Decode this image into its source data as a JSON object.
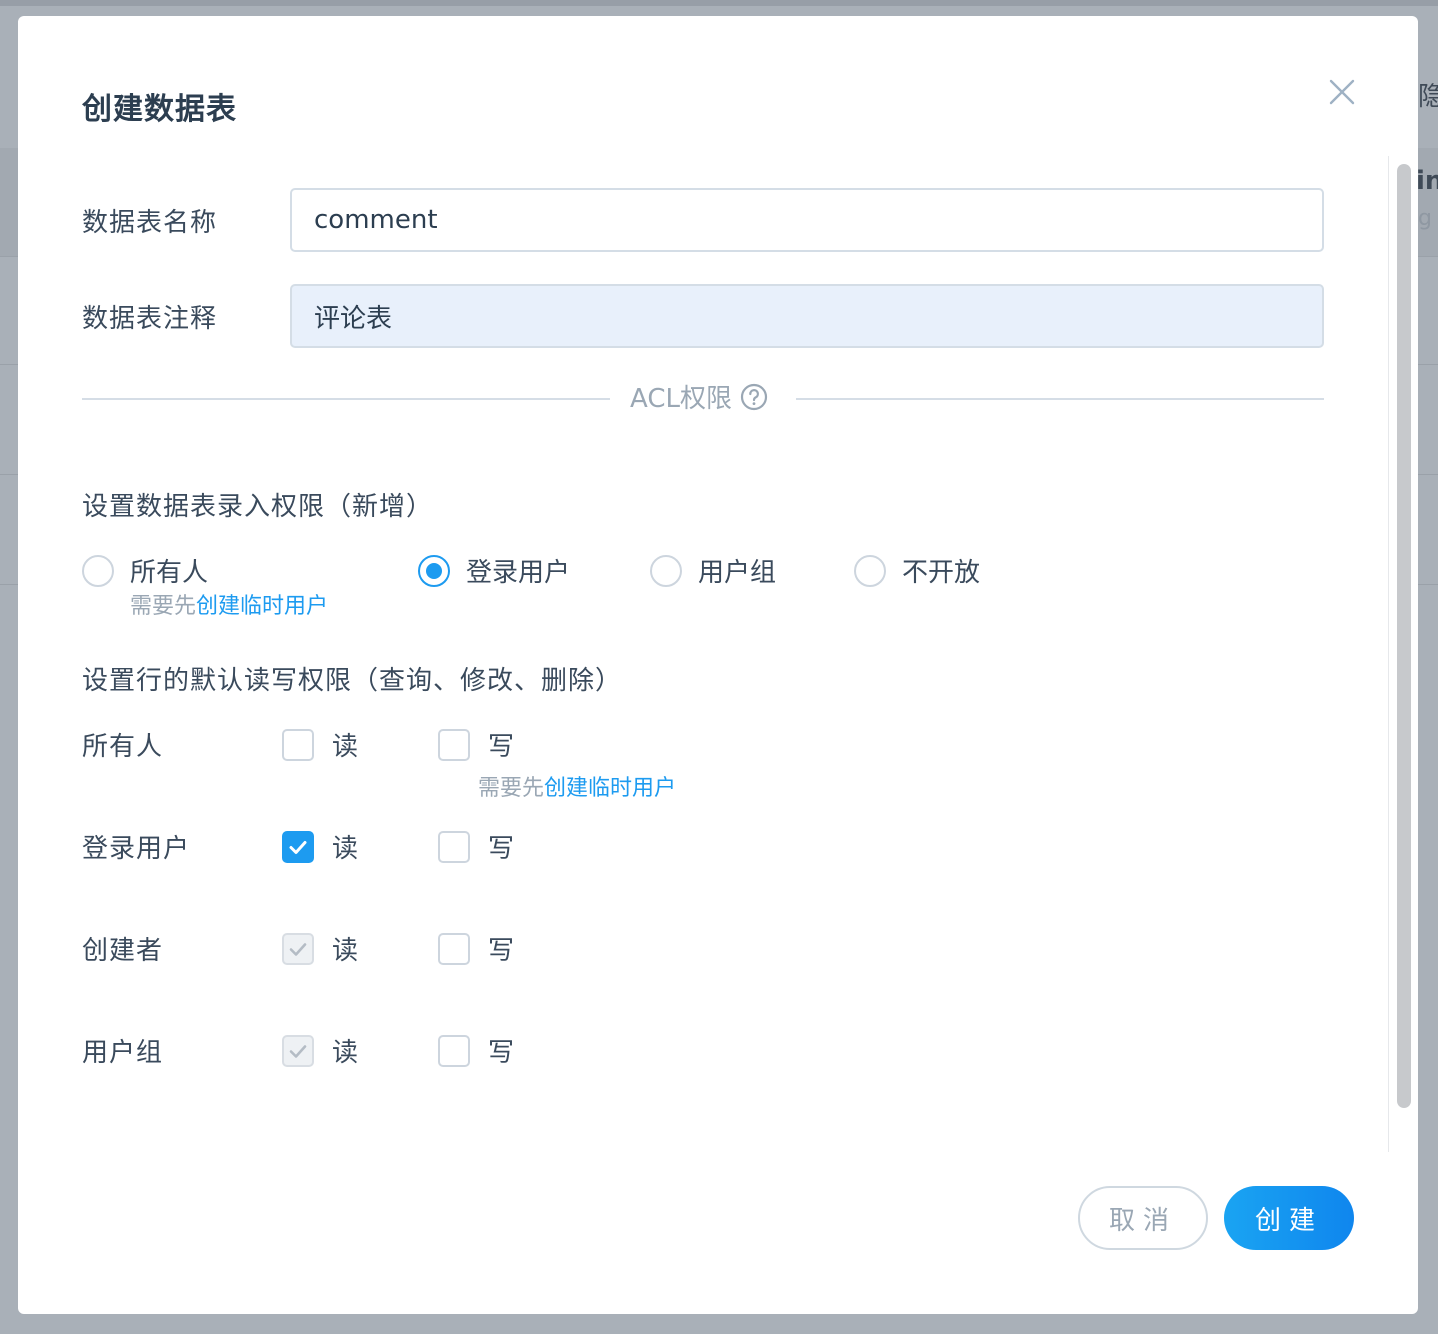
{
  "backdrop": {
    "peek_text_1": "隐",
    "peek_text_2": "in",
    "peek_text_3": "g"
  },
  "modal": {
    "title": "创建数据表",
    "close_icon": "close-icon"
  },
  "form": {
    "name_label": "数据表名称",
    "name_value": "comment",
    "comment_label": "数据表注释",
    "comment_value": "评论表"
  },
  "acl": {
    "divider_label": "ACL权限",
    "help_icon": "question-circle-icon",
    "write_section_title": "设置数据表录入权限（新增）",
    "write_options": [
      {
        "label": "所有人",
        "checked": false
      },
      {
        "label": "登录用户",
        "checked": true
      },
      {
        "label": "用户组",
        "checked": false
      },
      {
        "label": "不开放",
        "checked": false
      }
    ],
    "hint_prefix": "需要先",
    "hint_link": "创建临时用户",
    "row_section_title": "设置行的默认读写权限（查询、修改、删除）",
    "read_label": "读",
    "write_label": "写",
    "rows": [
      {
        "label": "所有人",
        "read": "unchecked",
        "write": "unchecked"
      },
      {
        "label": "登录用户",
        "read": "checked",
        "write": "unchecked"
      },
      {
        "label": "创建者",
        "read": "checked-disabled",
        "write": "unchecked"
      },
      {
        "label": "用户组",
        "read": "checked-disabled",
        "write": "unchecked"
      }
    ]
  },
  "footer": {
    "cancel_label": "取消",
    "create_label": "创建"
  },
  "colors": {
    "accent": "#1d9bf0",
    "text": "#3a4a5c",
    "muted": "#9aa7b4"
  }
}
